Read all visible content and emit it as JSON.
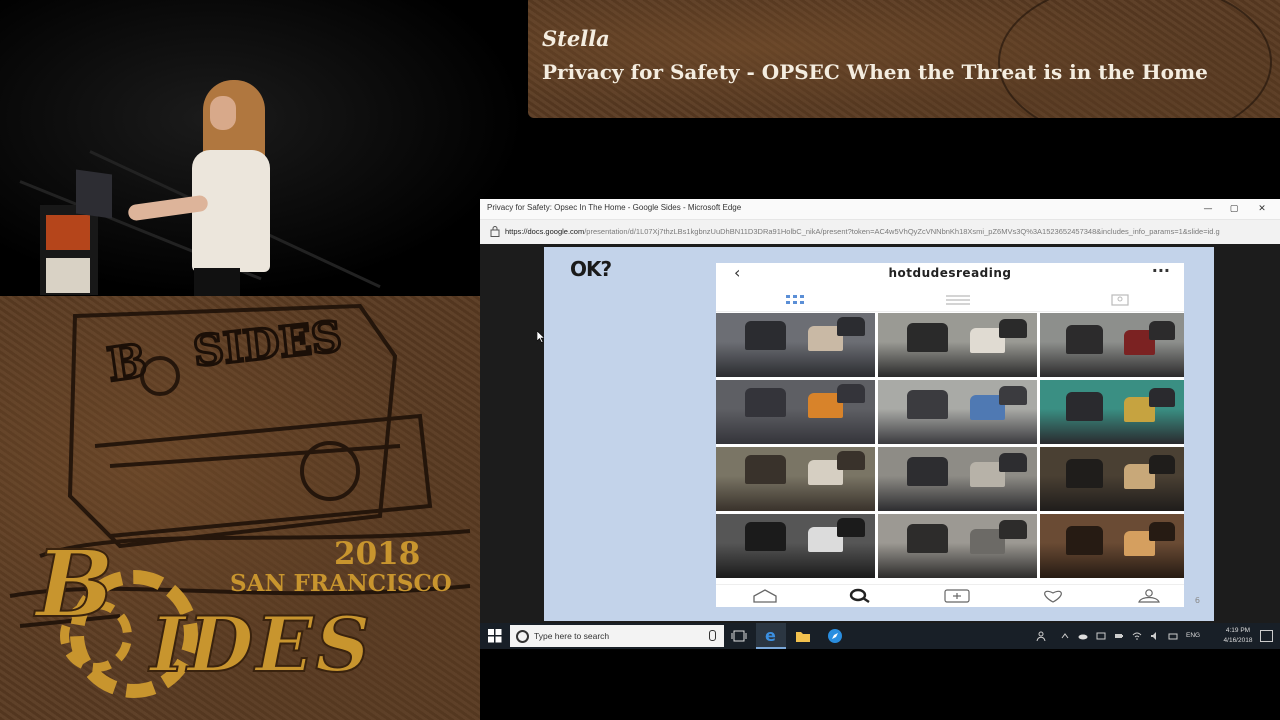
{
  "banner": {
    "speaker": "Stella",
    "title": "Privacy for Safety - OPSEC When the Threat is in the Home"
  },
  "event_logo": {
    "year": "2018",
    "city": "SAN FRANCISCO",
    "wordmark_b": "B",
    "wordmark_ides": "IDES",
    "accent_color": "#c8952e"
  },
  "browser": {
    "window_title": "Privacy for Safety: Opsec In The Home - Google Sides - Microsoft Edge",
    "controls": {
      "minimize": "—",
      "maximize": "▢",
      "close": "✕"
    },
    "url_host": "https://docs.google.com",
    "url_rest": "/presentation/d/1L07Xj7thzLBs1kgbnzUuDhBN11D3DRa91HolbC_nikA/present?token=AC4w5VhQyZcVNNbnKh18Xsmi_pZ6MVs3Q%3A1523652457348&includes_info_params=1&slide=id.g"
  },
  "slide": {
    "heading": "OK?",
    "page_number": "6",
    "background_color": "#c3d3ea",
    "phone": {
      "back_icon": "‹",
      "username": "hotdudesreading",
      "more_icon": "···",
      "tabs": [
        "grid-view-icon",
        "list-view-icon",
        "tagged-view-icon"
      ],
      "photos": 12,
      "bottom_nav": [
        "home-icon",
        "search-icon",
        "add-post-icon",
        "heart-icon",
        "profile-icon"
      ]
    }
  },
  "taskbar": {
    "search_placeholder": "Type here to search",
    "apps": [
      "task-view-icon",
      "edge-icon",
      "file-explorer-icon",
      "safari-like-icon"
    ],
    "language": "ENG",
    "time": "4:19 PM",
    "date": "4/16/2018"
  }
}
